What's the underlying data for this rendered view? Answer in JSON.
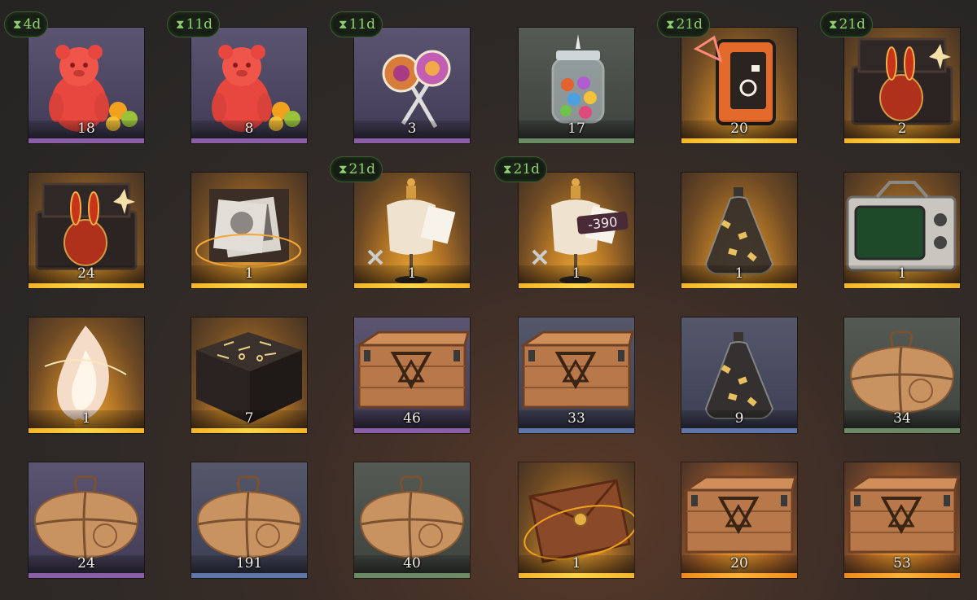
{
  "colors": {
    "purple": "#8a5fa6",
    "blue": "#5f76a8",
    "green": "#6c8a66",
    "gold": "#f4b42a",
    "orange": "#f08a1a",
    "timer_text": "#8fcf6c"
  },
  "timer_icon": "⧗",
  "items": [
    {
      "name": "gummy-bear",
      "icon": "gummy-bear-icon",
      "count": "18",
      "rarity": "purple",
      "timer": "4d"
    },
    {
      "name": "gummy-bear",
      "icon": "gummy-bear-icon",
      "count": "8",
      "rarity": "purple",
      "timer": "11d"
    },
    {
      "name": "lollipops",
      "icon": "lollipop-icon",
      "count": "3",
      "rarity": "purple",
      "timer": "11d"
    },
    {
      "name": "candy-jar",
      "icon": "candy-jar-icon",
      "count": "17",
      "rarity": "green",
      "timer": ""
    },
    {
      "name": "rune-device",
      "icon": "device-icon",
      "count": "20",
      "rarity": "gold",
      "timer": "21d"
    },
    {
      "name": "bunny-box",
      "icon": "bunny-box-icon",
      "count": "2",
      "rarity": "gold",
      "timer": "21d"
    },
    {
      "name": "bunny-crate",
      "icon": "bunny-box-icon",
      "count": "24",
      "rarity": "gold",
      "timer": ""
    },
    {
      "name": "photo-box",
      "icon": "photo-box-icon",
      "count": "1",
      "rarity": "gold",
      "timer": ""
    },
    {
      "name": "mannequin",
      "icon": "mannequin-icon",
      "count": "1",
      "rarity": "gold",
      "timer": "21d"
    },
    {
      "name": "mannequin-discount",
      "icon": "mannequin-icon",
      "count": "1",
      "rarity": "gold",
      "timer": "21d"
    },
    {
      "name": "bottle",
      "icon": "bottle-icon",
      "count": "1",
      "rarity": "gold",
      "timer": ""
    },
    {
      "name": "radio-tv",
      "icon": "radio-icon",
      "count": "1",
      "rarity": "gold",
      "timer": ""
    },
    {
      "name": "spirit-flame",
      "icon": "flame-icon",
      "count": "1",
      "rarity": "gold",
      "timer": ""
    },
    {
      "name": "rune-cube",
      "icon": "cube-icon",
      "count": "7",
      "rarity": "gold",
      "timer": ""
    },
    {
      "name": "wood-crate",
      "icon": "crate-icon",
      "count": "46",
      "rarity": "purple",
      "timer": ""
    },
    {
      "name": "wood-crate",
      "icon": "crate-icon",
      "count": "33",
      "rarity": "blue",
      "timer": ""
    },
    {
      "name": "bottle",
      "icon": "bottle-icon",
      "count": "9",
      "rarity": "blue",
      "timer": ""
    },
    {
      "name": "parcel",
      "icon": "parcel-icon",
      "count": "34",
      "rarity": "green",
      "timer": ""
    },
    {
      "name": "parcel",
      "icon": "parcel-icon",
      "count": "24",
      "rarity": "purple",
      "timer": ""
    },
    {
      "name": "parcel",
      "icon": "parcel-icon",
      "count": "191",
      "rarity": "blue",
      "timer": ""
    },
    {
      "name": "parcel",
      "icon": "parcel-icon",
      "count": "40",
      "rarity": "green",
      "timer": ""
    },
    {
      "name": "envelope",
      "icon": "envelope-icon",
      "count": "1",
      "rarity": "gold",
      "timer": ""
    },
    {
      "name": "wood-crate",
      "icon": "crate-icon",
      "count": "20",
      "rarity": "orange",
      "timer": ""
    },
    {
      "name": "wood-crate",
      "icon": "crate-icon",
      "count": "53",
      "rarity": "orange",
      "timer": ""
    }
  ],
  "discount_label": "-390"
}
